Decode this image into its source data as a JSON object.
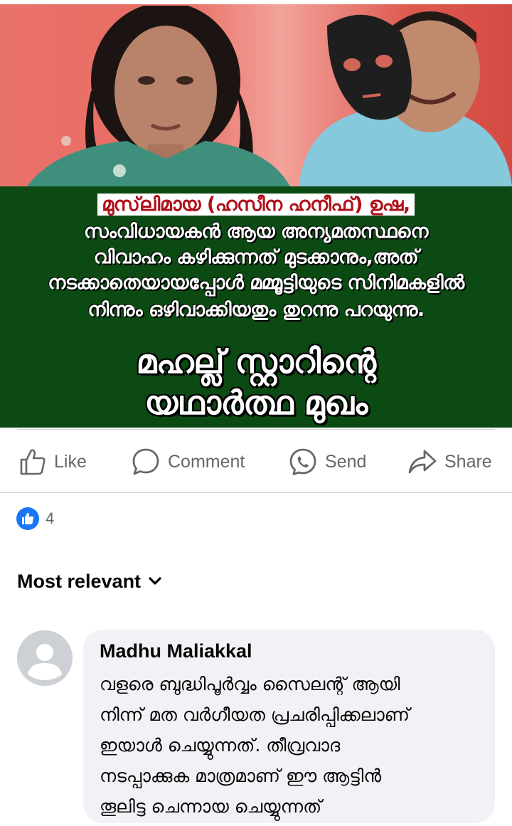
{
  "post_image": {
    "caption_lines": [
      "മുസ്‌ലിമായ (ഹസീന ഹനീഫ്) ഉഷ,",
      "സംവിധായകൻ ആയ അന്യമതസ്ഥനെ",
      "വിവാഹം കഴിക്കുന്നത് മുടക്കാനും,അത്",
      "നടക്കാതെയായപ്പോൾ മമ്മൂട്ടിയുടെ സിനിമകളിൽ",
      "നിന്നും ഒഴിവാക്കിയതും തുറന്നു പറയുന്നു."
    ],
    "headline_lines": [
      "മഹല്ല് സ്റ്റാറിന്റെ",
      "യഥാർത്ഥ മുഖം"
    ],
    "colors": {
      "banner_bg": "#0c4a14",
      "highlight_text": "#b0111b"
    }
  },
  "actions": {
    "like": {
      "label": "Like",
      "icon": "thumbs-up-icon"
    },
    "comment": {
      "label": "Comment",
      "icon": "comment-bubble-icon"
    },
    "send": {
      "label": "Send",
      "icon": "messenger-icon"
    },
    "share": {
      "label": "Share",
      "icon": "share-arrow-icon"
    }
  },
  "reactions": {
    "icon": "like-reaction-icon",
    "count": "4",
    "color": "#1877f2"
  },
  "sort": {
    "label": "Most relevant",
    "icon": "chevron-down-icon"
  },
  "comment": {
    "author": "Madhu Maliakkal",
    "text_lines": [
      "വളരെ ബുദ്ധിപൂർവ്വം സൈലന്റ് ആയി",
      "നിന്ന് മത വർഗീയത പ്രചരിപ്പിക്കലാണ്",
      "ഇയാൾ ചെയ്യുന്നത്. തീവ്രവാദ",
      "നടപ്പാക്കുക മാത്രമാണ് ഈ ആട്ടിൻ",
      "തൂലിട്ട ചെന്നായ ചെയ്യുന്നത്"
    ],
    "avatar_icon": "default-avatar-icon"
  }
}
